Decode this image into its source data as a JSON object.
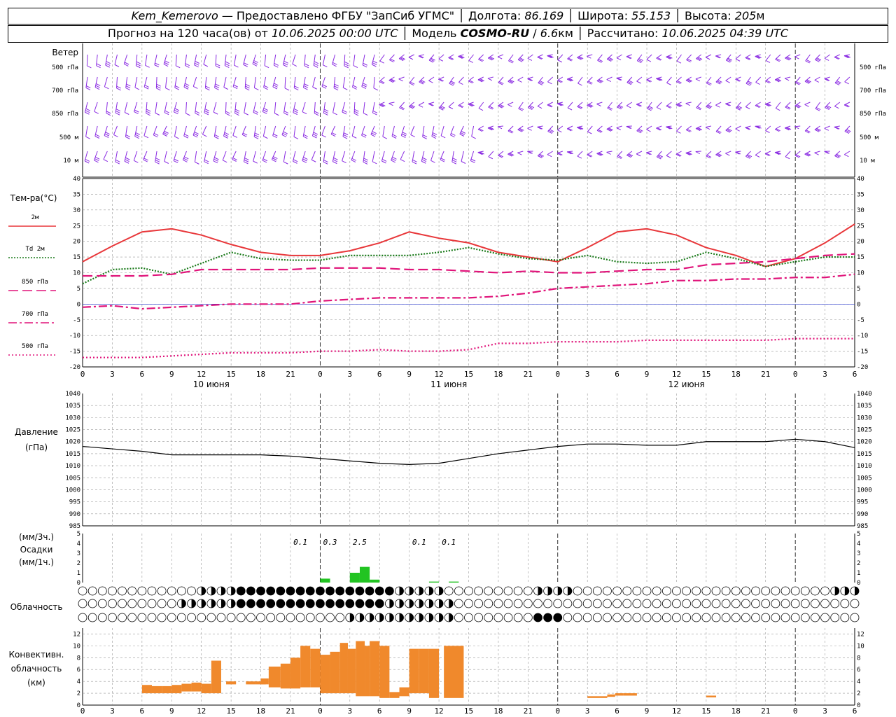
{
  "header": {
    "station": "Kem_Kemerovo",
    "provider": "— Предоставлено ФГБУ \"ЗапСиб УГМС\"",
    "lon_label": "Долгота:",
    "lon": "86.169",
    "lat_label": "Широта:",
    "lat": "55.153",
    "alt_label": "Высота:",
    "alt": "205",
    "alt_unit": "м",
    "fc_label": "Прогноз на 120 часа(ов) от",
    "fc_time": "10.06.2025 00:00 UTC",
    "model_label": "Модель",
    "model": "COSMO-RU",
    "res": "6.6",
    "res_unit": "км",
    "calc_label": "Рассчитано:",
    "calc_time": "10.06.2025 04:39 UTC"
  },
  "panels": {
    "wind": {
      "title": "Ветер",
      "levels": [
        "500 гПа",
        "700 гПа",
        "850 гПа",
        "500 м",
        "10  м"
      ]
    },
    "temp": {
      "title": "Тем-ра(°C)",
      "legend": [
        {
          "label": "2м",
          "color": "#e8373a",
          "style": "solid"
        },
        {
          "label": "Td  2м",
          "color": "#1a7a1a",
          "style": "dotted"
        },
        {
          "label": "850 гПа",
          "color": "#e0147a",
          "style": "dash"
        },
        {
          "label": "700 гПа",
          "color": "#e0147a",
          "style": "dashdot"
        },
        {
          "label": "500 гПа",
          "color": "#e0147a",
          "style": "dot"
        }
      ]
    },
    "pressure": {
      "title": "Давление",
      "unit": "(гПа)"
    },
    "precip": {
      "unit_top": "(мм/3ч.)",
      "title": "Осадки",
      "unit_bottom": "(мм/1ч.)"
    },
    "cloud": {
      "title": "Облачность"
    },
    "conv": {
      "title_lines": [
        "Конвективн.",
        "облачность",
        "(км)"
      ]
    }
  },
  "time_axis": {
    "ticks": [
      "0",
      "3",
      "6",
      "9",
      "12",
      "15",
      "18",
      "21",
      "0",
      "3",
      "6",
      "9",
      "12",
      "15",
      "18",
      "21",
      "0",
      "3",
      "6",
      "9",
      "12",
      "15",
      "18",
      "21",
      "0",
      "3",
      "6"
    ],
    "days": [
      "10 июня",
      "11 июня",
      "12 июня"
    ]
  },
  "colors": {
    "t2m": "#e8373a",
    "td": "#1a7a1a",
    "upper": "#e0147a",
    "wind": "#8a2be2",
    "precip": "#22c422",
    "conv": "#f0892c"
  },
  "chart_data": [
    {
      "type": "line",
      "title": "Тем-ра(°C)",
      "x_unit": "hours since 10.06.2025 00:00 UTC",
      "ylim": [
        -20,
        40
      ],
      "x": [
        0,
        3,
        6,
        9,
        12,
        15,
        18,
        21,
        24,
        27,
        30,
        33,
        36,
        39,
        42,
        45,
        48,
        51,
        54,
        57,
        60,
        63,
        66,
        69,
        72,
        75,
        78
      ],
      "series": [
        {
          "name": "2м",
          "values": [
            13.5,
            18.5,
            23,
            24,
            22,
            19,
            16.5,
            15.5,
            15.5,
            17,
            19.5,
            23,
            21,
            19.5,
            16.5,
            15,
            13.5,
            18,
            23,
            24,
            22,
            18,
            15.5,
            12,
            14.5,
            19.5,
            25.5
          ]
        },
        {
          "name": "Td 2м",
          "values": [
            6.5,
            11,
            11.5,
            9.5,
            13,
            16.5,
            14.5,
            14,
            14,
            15.5,
            15.5,
            15.5,
            16.5,
            18,
            16,
            14.5,
            14,
            15.5,
            13.5,
            13,
            13.5,
            16.5,
            14.5,
            12,
            13.5,
            15,
            15
          ]
        },
        {
          "name": "850 гПа",
          "values": [
            9,
            9,
            9,
            9.5,
            11,
            11,
            11,
            11,
            11.5,
            11.5,
            11.5,
            11,
            11,
            10.5,
            10,
            10.5,
            10,
            10,
            10.5,
            11,
            11,
            12.5,
            13,
            13.5,
            14.5,
            15.5,
            16
          ]
        },
        {
          "name": "700 гПа",
          "values": [
            -1,
            -0.5,
            -1.5,
            -1,
            -0.5,
            0,
            0,
            0,
            1,
            1.5,
            2,
            2,
            2,
            2,
            2.5,
            3.5,
            5,
            5.5,
            6,
            6.5,
            7.5,
            7.5,
            8,
            8,
            8.5,
            8.5,
            9.5
          ]
        },
        {
          "name": "500 гПа",
          "values": [
            -17,
            -17,
            -17,
            -16.5,
            -16,
            -15.5,
            -15.5,
            -15.5,
            -15,
            -15,
            -14.5,
            -15,
            -15,
            -14.5,
            -12.5,
            -12.5,
            -12,
            -12,
            -12,
            -11.5,
            -11.5,
            -11.5,
            -11.5,
            -11.5,
            -11,
            -11,
            -11
          ]
        }
      ]
    },
    {
      "type": "line",
      "title": "Давление",
      "ylabel": "(гПа)",
      "ylim": [
        985,
        1040
      ],
      "x": [
        0,
        3,
        6,
        9,
        12,
        15,
        18,
        21,
        24,
        27,
        30,
        33,
        36,
        39,
        42,
        45,
        48,
        51,
        54,
        57,
        60,
        63,
        66,
        69,
        72,
        75,
        78
      ],
      "series": [
        {
          "name": "Давление",
          "values": [
            1018,
            1017,
            1016,
            1014.5,
            1014.5,
            1014.5,
            1014.5,
            1014,
            1013,
            1012,
            1011,
            1010.5,
            1011,
            1013,
            1015,
            1016.5,
            1018,
            1019,
            1019,
            1018.5,
            1018.5,
            1020,
            1020,
            1020,
            1021,
            1020,
            1017.5
          ]
        }
      ]
    },
    {
      "type": "bar",
      "title": "Осадки",
      "x_unit": "hours",
      "ylim": [
        0,
        5
      ],
      "bars_1h": [
        {
          "x": 24,
          "value": 0.4
        },
        {
          "x": 27,
          "value": 1
        },
        {
          "x": 28,
          "value": 1.6
        },
        {
          "x": 29,
          "value": 0.3
        },
        {
          "x": 35,
          "value": 0.1
        },
        {
          "x": 37,
          "value": 0.1
        }
      ],
      "totals_3h": [
        {
          "x": 22,
          "label": "0.1"
        },
        {
          "x": 25,
          "label": "0.3"
        },
        {
          "x": 28,
          "label": "2.5"
        },
        {
          "x": 34,
          "label": "0.1"
        },
        {
          "x": 37,
          "label": "0.1"
        }
      ]
    },
    {
      "type": "bar",
      "title": "Конвективн. облачность",
      "ylabel": "(км)",
      "ylim": [
        0,
        13
      ],
      "ranges": [
        [
          6,
          7,
          2,
          3.4
        ],
        [
          7,
          8,
          2,
          3.2
        ],
        [
          8,
          9,
          2,
          3.2
        ],
        [
          9,
          10,
          2,
          3.4
        ],
        [
          10,
          11,
          2.3,
          3.6
        ],
        [
          11,
          12,
          2.3,
          3.8
        ],
        [
          12,
          13,
          2,
          3.6
        ],
        [
          13,
          14,
          2,
          7.5
        ],
        [
          14.5,
          15.5,
          3.5,
          4
        ],
        [
          16.5,
          17.5,
          3.5,
          4
        ],
        [
          17.5,
          18.5,
          3.5,
          4
        ],
        [
          18,
          18.8,
          3.5,
          4.5
        ],
        [
          18.8,
          20,
          3,
          6.5
        ],
        [
          20,
          21,
          2.8,
          7
        ],
        [
          21,
          22,
          2.8,
          8
        ],
        [
          22,
          23,
          3,
          10
        ],
        [
          23,
          24,
          3,
          9.5
        ],
        [
          24,
          25,
          2,
          8.5
        ],
        [
          25,
          26,
          2,
          9
        ],
        [
          26,
          26.8,
          2,
          10.5
        ],
        [
          26.8,
          27.6,
          2,
          9.5
        ],
        [
          27.6,
          28.5,
          1.5,
          10.8
        ],
        [
          28.5,
          29,
          1.5,
          10
        ],
        [
          29,
          30,
          1.5,
          10.8
        ],
        [
          30,
          31,
          1.2,
          10
        ],
        [
          31,
          32,
          1.2,
          2.2
        ],
        [
          32,
          33,
          1.5,
          3
        ],
        [
          33,
          34,
          2,
          9.5
        ],
        [
          34,
          35,
          2,
          9.5
        ],
        [
          35,
          36,
          1.2,
          9.5
        ],
        [
          36.5,
          38.5,
          1.2,
          10
        ],
        [
          51,
          53,
          1.2,
          1.5
        ],
        [
          53,
          53.8,
          1.4,
          1.8
        ],
        [
          53.8,
          54.6,
          1.6,
          2
        ],
        [
          54.6,
          56,
          1.6,
          2
        ],
        [
          63,
          64,
          1.3,
          1.6
        ]
      ]
    }
  ]
}
